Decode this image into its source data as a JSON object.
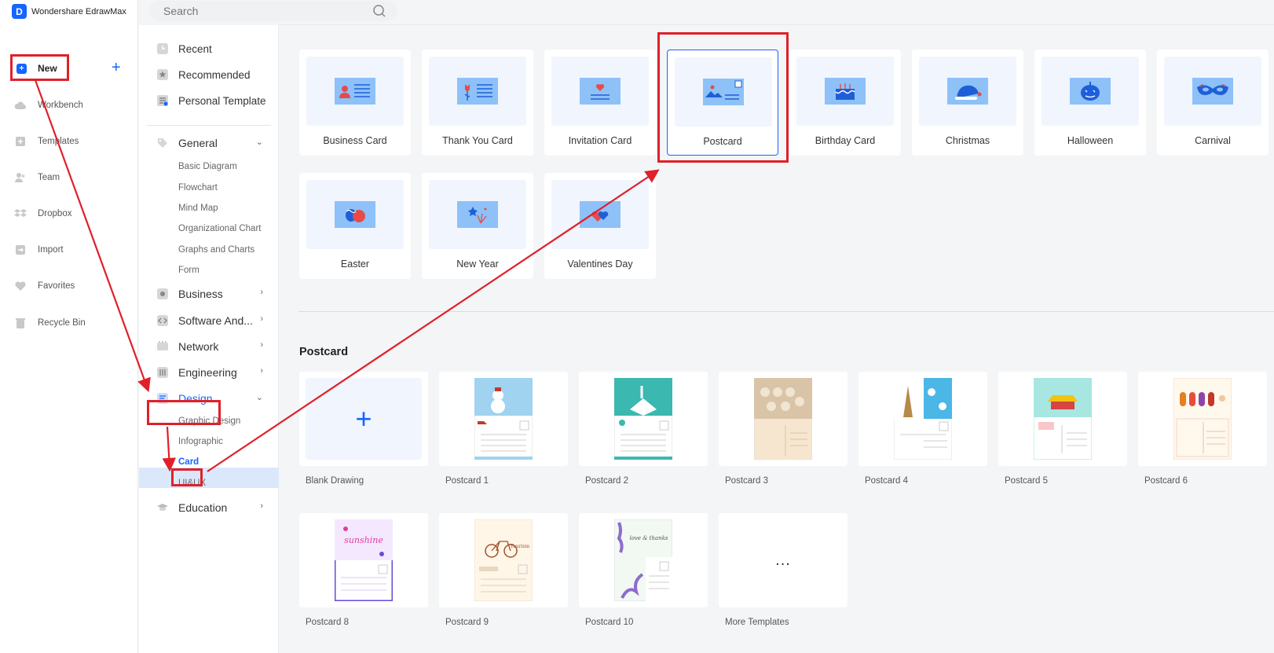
{
  "app": {
    "title": "Wondershare EdrawMax"
  },
  "search": {
    "placeholder": "Search"
  },
  "leftnav": {
    "new_label": "New",
    "items": [
      {
        "label": "Workbench",
        "icon": "cloud-icon"
      },
      {
        "label": "Templates",
        "icon": "templates-icon"
      },
      {
        "label": "Team",
        "icon": "team-icon"
      },
      {
        "label": "Dropbox",
        "icon": "dropbox-icon"
      },
      {
        "label": "Import",
        "icon": "import-icon"
      },
      {
        "label": "Favorites",
        "icon": "heart-icon"
      },
      {
        "label": "Recycle Bin",
        "icon": "trash-icon"
      }
    ]
  },
  "categories": {
    "top": [
      "Recent",
      "Recommended",
      "Personal Template"
    ],
    "groups": {
      "general": "General",
      "business": "Business",
      "software": "Software And...",
      "network": "Network",
      "engineering": "Engineering",
      "design": "Design",
      "education": "Education"
    },
    "general_subs": [
      "Basic Diagram",
      "Flowchart",
      "Mind Map",
      "Organizational Chart",
      "Graphs and Charts",
      "Form"
    ],
    "design_subs": [
      "Graphic Design",
      "Infographic",
      "Card",
      "UI&UX"
    ]
  },
  "card_types": [
    "Business Card",
    "Thank You Card",
    "Invitation Card",
    "Postcard",
    "Birthday Card",
    "Christmas",
    "Halloween",
    "Carnival",
    "Easter",
    "New Year",
    "Valentines Day"
  ],
  "section": {
    "title": "Postcard"
  },
  "templates": [
    "Blank Drawing",
    "Postcard 1",
    "Postcard 2",
    "Postcard 3",
    "Postcard 4",
    "Postcard 5",
    "Postcard 6",
    "Postcard 8",
    "Postcard 9",
    "Postcard 10",
    "More Templates"
  ],
  "more_glyph": "...",
  "colors": {
    "accent": "#1565ff",
    "annotation": "#e0202a",
    "thumb_bg": "#f1f5fd",
    "active_row": "#dbe8fc"
  }
}
